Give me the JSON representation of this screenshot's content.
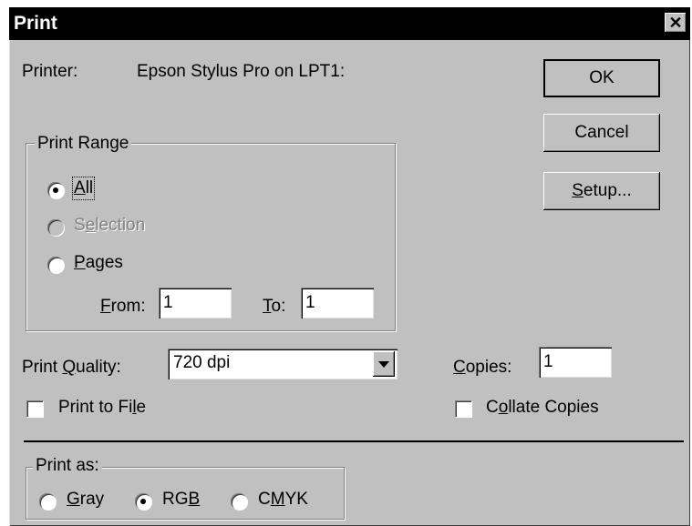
{
  "dialog": {
    "title": "Print",
    "close_glyph": "✕"
  },
  "printer": {
    "label": "Printer:",
    "value": "Epson Stylus Pro on LPT1:"
  },
  "buttons": {
    "ok": "OK",
    "cancel": "Cancel",
    "setup": "Setup..."
  },
  "print_range": {
    "legend": "Print Range",
    "all": "All",
    "selection": "Selection",
    "pages": "Pages",
    "selected": "All",
    "from_label": "From:",
    "from_value": "1",
    "to_label": "To:",
    "to_value": "1"
  },
  "quality": {
    "label": "Print Quality:",
    "value": "720 dpi"
  },
  "copies": {
    "label": "Copies:",
    "value": "1"
  },
  "print_to_file": {
    "label": "Print to File",
    "checked": false
  },
  "collate": {
    "label": "Collate Copies",
    "checked": false
  },
  "print_as": {
    "legend": "Print as:",
    "options": [
      "Gray",
      "RGB",
      "CMYK"
    ],
    "selected": "RGB"
  },
  "icons": {
    "close": "close-icon",
    "dropdown": "chevron-down-icon"
  }
}
